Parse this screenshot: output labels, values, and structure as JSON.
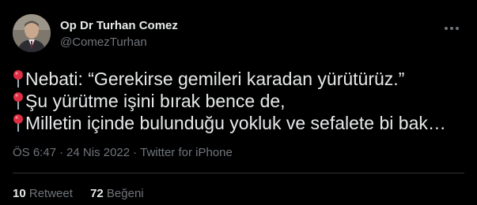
{
  "author": {
    "display_name": "Op Dr Turhan Comez",
    "handle": "@ComezTurhan",
    "avatar": "profile-photo"
  },
  "tweet": {
    "lines": [
      {
        "icon": "round-pushpin-icon",
        "text": "Nebati: “Gerekirse gemileri karadan yürütürüz.”"
      },
      {
        "icon": "round-pushpin-icon",
        "text": "Şu yürütme işini bırak bence de,"
      },
      {
        "icon": "round-pushpin-icon",
        "text": "Milletin içinde bulunduğu yokluk ve sefalete bi bak…"
      }
    ],
    "time": "ÖS 6:47",
    "date": "24 Nis 2022",
    "source": "Twitter for iPhone",
    "separator": "·"
  },
  "stats": {
    "retweets_count": "10",
    "retweets_label": "Retweet",
    "likes_count": "72",
    "likes_label": "Beğeni"
  },
  "colors": {
    "background": "#000000",
    "text_primary": "#e7e9ea",
    "text_secondary": "#71767b",
    "divider": "#2f3336",
    "pin_red": "#dd2e44"
  }
}
